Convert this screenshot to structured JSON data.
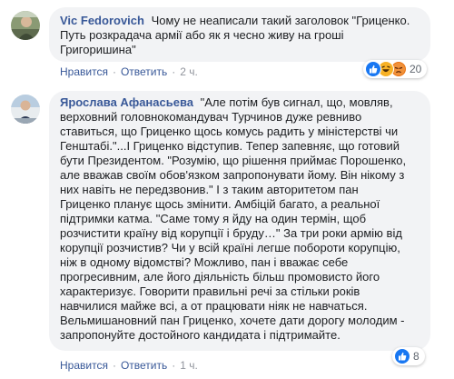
{
  "comments": [
    {
      "author": "Vic Fedorovich",
      "text": "Чому не неаписали такий заголовок \"Гриценко.\nПуть розкрадача армії або як я чесно живу на гроші\nГригоришина\"",
      "actions": {
        "like": "Нравится",
        "reply": "Ответить",
        "time": "2 ч."
      },
      "reactions": {
        "icons": [
          "like-icon",
          "haha-icon",
          "angry-icon"
        ],
        "count": "20"
      }
    },
    {
      "author": "Ярослава Афанасьева",
      "lines": [
        "\"Але потім був сигнал, що, мовляв,",
        "верховний головнокомандувач Турчинов дуже ревниво",
        "ставиться, що Гриценко щось комусь радить у міністерстві чи",
        "Генштабі.\"...І Гриценко відступив. Тепер запевняє, що готовий",
        "бути Президентом. \"Розумію, що рішення приймає Порошенко,",
        "але вважав своїм обов'язком запропонувати йому. Він нікому з",
        "них навіть не передзвонив.\" І з таким авторитетом пан",
        "Гриценко планує щось змінити. Амбіцій багато, а реальної",
        "підтримки катма. \"Саме тому я йду на один термін, щоб",
        "розчистити країну від корупції і бруду…\" За три роки армію від",
        "корупції розчистив? Чи у всій країні легше побороти корупцію,",
        "ніж в одному відомстві? Можливо, пан і вважає себе",
        "прогресивним, але його діяльність більш промовисто його",
        "характеризує. Говорити правильні речі за стільки років",
        "навчилися майже всі, а от працювати ніяк не навчаться.",
        "Вельмишановний пан Гриценко, хочете дати дорогу молодим -",
        "запропонуйте достойного кандидата і підтримайте."
      ],
      "actions": {
        "like": "Нравится",
        "reply": "Ответить",
        "time": "1 ч."
      },
      "reactions": {
        "icons": [
          "like-icon"
        ],
        "count": "8"
      }
    }
  ],
  "colors": {
    "author": "#385898",
    "bubble": "#f2f3f5",
    "like": "#1877f2",
    "haha": "#f7b125",
    "angry": "#e9710f"
  }
}
